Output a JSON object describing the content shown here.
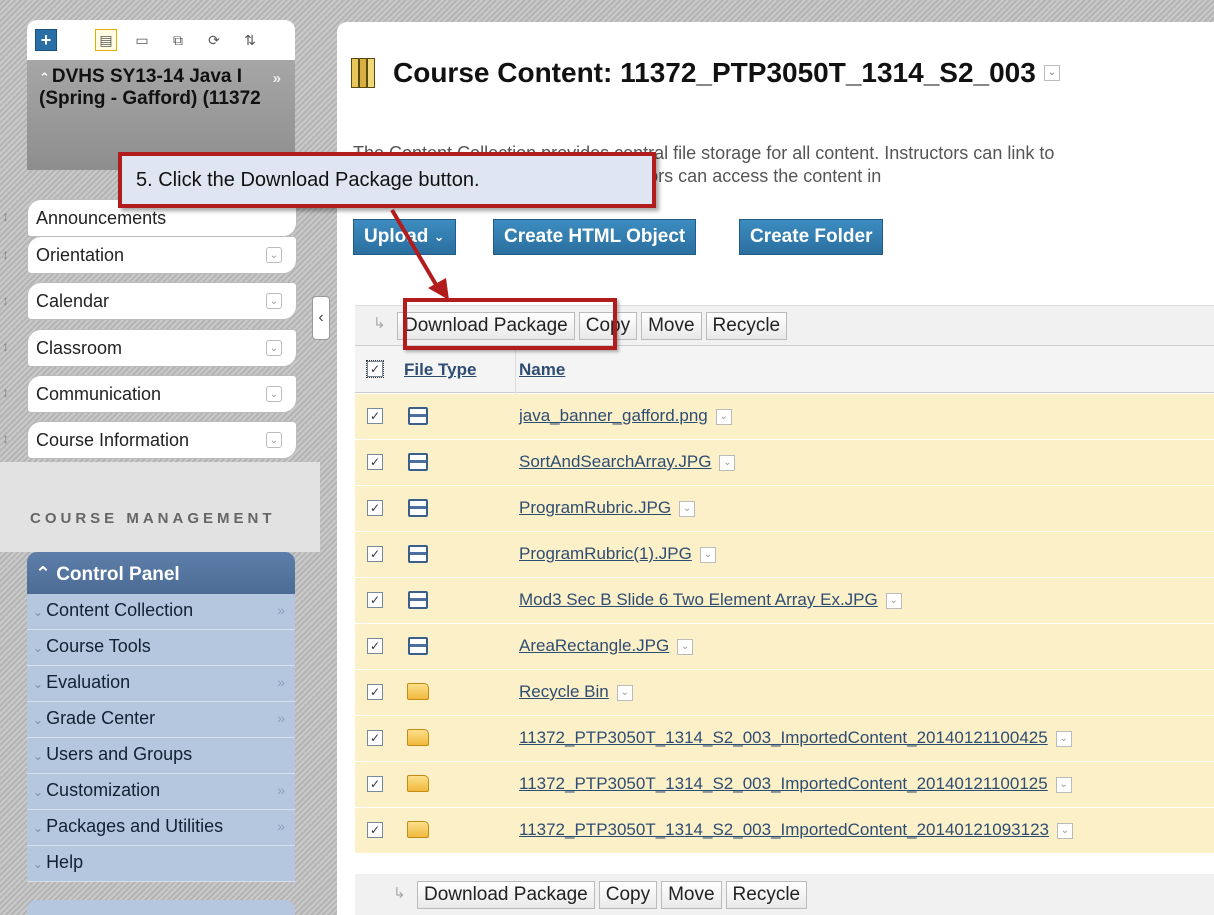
{
  "course_menu": {
    "title": "DVHS SY13-14 Java I (Spring - Gafford) (11372",
    "items": [
      "Announcements",
      "Orientation",
      "Calendar",
      "Classroom",
      "Communication",
      "Course Information"
    ]
  },
  "course_management": {
    "heading": "COURSE MANAGEMENT",
    "control_panel_title": "Control Panel",
    "items": [
      "Content Collection",
      "Course Tools",
      "Evaluation",
      "Grade Center",
      "Users and Groups",
      "Customization",
      "Packages and Utilities",
      "Help"
    ]
  },
  "main": {
    "title": "Course Content: 11372_PTP3050T_1314_S2_003",
    "description_line1": "The Content Collection provides central file storage for all content. Instructors can link to",
    "description_line2": "content in the Control Panel, Instructors can access the content in",
    "buttons": {
      "upload": "Upload",
      "create_html": "Create HTML Object",
      "create_folder": "Create Folder"
    },
    "actions": {
      "download": "Download Package",
      "copy": "Copy",
      "move": "Move",
      "recycle": "Recycle"
    },
    "columns": {
      "file_type": "File Type",
      "name": "Name"
    },
    "files": [
      {
        "name": "java_banner_gafford.png",
        "type": "image"
      },
      {
        "name": "SortAndSearchArray.JPG",
        "type": "image"
      },
      {
        "name": "ProgramRubric.JPG",
        "type": "image"
      },
      {
        "name": "ProgramRubric(1).JPG",
        "type": "image"
      },
      {
        "name": "Mod3 Sec B Slide 6 Two Element Array Ex.JPG",
        "type": "image"
      },
      {
        "name": "AreaRectangle.JPG",
        "type": "image"
      },
      {
        "name": "Recycle Bin",
        "type": "folder"
      },
      {
        "name": "11372_PTP3050T_1314_S2_003_ImportedContent_20140121100425",
        "type": "folder"
      },
      {
        "name": "11372_PTP3050T_1314_S2_003_ImportedContent_20140121100125",
        "type": "folder"
      },
      {
        "name": "11372_PTP3050T_1314_S2_003_ImportedContent_20140121093123",
        "type": "folder"
      }
    ]
  },
  "callout": {
    "text": "5. Click the Download Package button."
  },
  "colors": {
    "accent": "#2a6f9f",
    "row": "#fcf0c8",
    "highlight": "#b11c1c"
  }
}
